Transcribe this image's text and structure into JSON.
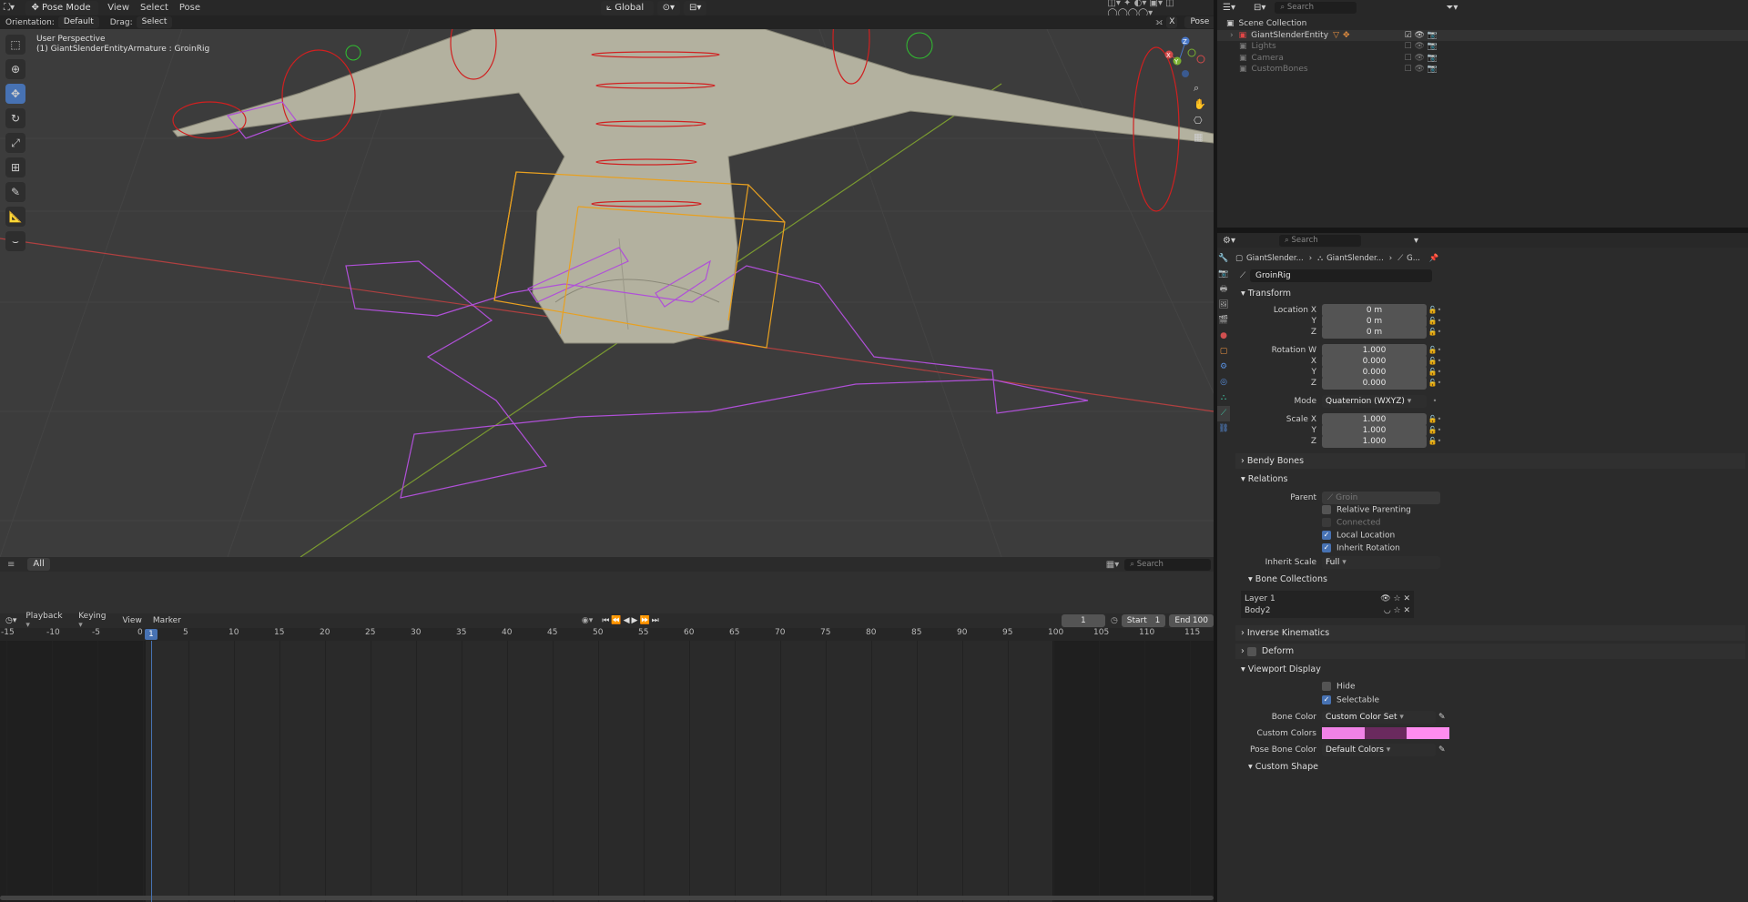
{
  "header": {
    "mode": "Pose Mode",
    "menus": [
      "View",
      "Select",
      "Pose"
    ],
    "orientation_label": "Orientation:",
    "orientation_value": "Default",
    "drag_label": "Drag:",
    "drag_value": "Select Box",
    "transform_orient": "Global",
    "pose_options": "Pose Options",
    "x_btn": "X"
  },
  "viewport": {
    "perspective": "User Perspective",
    "active": "(1) GiantSlenderEntityArmature : GroinRig",
    "gizmo": {
      "x": "X",
      "y": "Y",
      "z": "Z"
    }
  },
  "outliner": {
    "search_placeholder": "Search",
    "collection": "Scene Collection",
    "items": [
      "GiantSlenderEntity",
      "Lights",
      "Camera",
      "CustomBones"
    ]
  },
  "properties": {
    "search_placeholder": "Search",
    "breadcrumb": [
      "GiantSlender...",
      "GiantSlender...",
      "G..."
    ],
    "bone_name": "GroinRig",
    "transform_title": "Transform",
    "location": {
      "label_x": "Location X",
      "label_y": "Y",
      "label_z": "Z",
      "x": "0 m",
      "y": "0 m",
      "z": "0 m"
    },
    "rotation": {
      "label_w": "Rotation W",
      "label_x": "X",
      "label_y": "Y",
      "label_z": "Z",
      "w": "1.000",
      "x": "0.000",
      "y": "0.000",
      "z": "0.000"
    },
    "mode_label": "Mode",
    "mode_value": "Quaternion (WXYZ)",
    "scale": {
      "label_x": "Scale X",
      "label_y": "Y",
      "label_z": "Z",
      "x": "1.000",
      "y": "1.000",
      "z": "1.000"
    },
    "bendy_bones": "Bendy Bones",
    "relations_title": "Relations",
    "parent_label": "Parent",
    "parent_value": "Groin",
    "relative_parenting": "Relative Parenting",
    "connected": "Connected",
    "local_location": "Local Location",
    "inherit_rotation": "Inherit Rotation",
    "inherit_scale_label": "Inherit Scale",
    "inherit_scale_value": "Full",
    "bone_collections_title": "Bone Collections",
    "collections": [
      "Layer 1",
      "Body2"
    ],
    "inverse_kinematics": "Inverse Kinematics",
    "deform": "Deform",
    "viewport_display": "Viewport Display",
    "hide": "Hide",
    "selectable": "Selectable",
    "bone_color_label": "Bone Color",
    "bone_color_value": "Custom Color Set",
    "custom_colors_label": "Custom Colors",
    "pose_bone_color_label": "Pose Bone Color",
    "pose_bone_color_value": "Default Colors",
    "custom_shape": "Custom Shape",
    "colors": {
      "c1": "#f082e6",
      "c2": "#6a2a5e",
      "c3": "#ff8cf0"
    }
  },
  "asset_bar": {
    "all": "All",
    "search_placeholder": "Search"
  },
  "timeline": {
    "menus": [
      "Playback",
      "Keying",
      "View",
      "Marker"
    ],
    "current_frame": "1",
    "start_label": "Start",
    "start": "1",
    "end_label": "End",
    "end": "100",
    "ticks": [
      "-15",
      "-10",
      "-5",
      "0",
      "5",
      "10",
      "15",
      "20",
      "25",
      "30",
      "35",
      "40",
      "45",
      "50",
      "55",
      "60",
      "65",
      "70",
      "75",
      "80",
      "85",
      "90",
      "95",
      "100",
      "105",
      "110",
      "115"
    ],
    "playhead": "1"
  }
}
